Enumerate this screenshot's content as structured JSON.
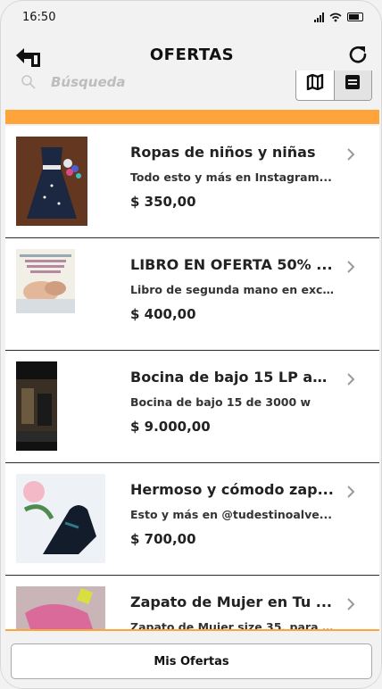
{
  "status_bar": {
    "time": "16:50"
  },
  "header": {
    "title": "OFERTAS"
  },
  "search": {
    "placeholder": "Búsqueda"
  },
  "items": [
    {
      "title": "Ropas de niños y niñas",
      "description": "Todo esto y más en Instagram...",
      "price": "$ 350,00"
    },
    {
      "title": "LIBRO EN OFERTA 50% ...",
      "description": "Libro de segunda mano en exc...",
      "price": "$ 400,00"
    },
    {
      "title": "Bocina de bajo 15 LP au...",
      "description": "Bocina de bajo 15 de 3000 w",
      "price": "$ 9.000,00"
    },
    {
      "title": "Hermoso y cómodo zap...",
      "description": "Esto y más en @tudestinoalve...",
      "price": "$ 700,00"
    },
    {
      "title": "Zapato de Mujer en Tu ...",
      "description": "Zapato de Mujer size 35, para ...",
      "price": ""
    }
  ],
  "footer": {
    "my_offers_label": "Mis Ofertas"
  },
  "colors": {
    "accent": "#ffa43a",
    "background": "#f2f2f2",
    "divider": "#2a2a2a"
  },
  "icons": [
    "back-arrow-icon",
    "refresh-icon",
    "search-icon",
    "map-icon",
    "list-view-icon",
    "chevron-right-icon"
  ]
}
